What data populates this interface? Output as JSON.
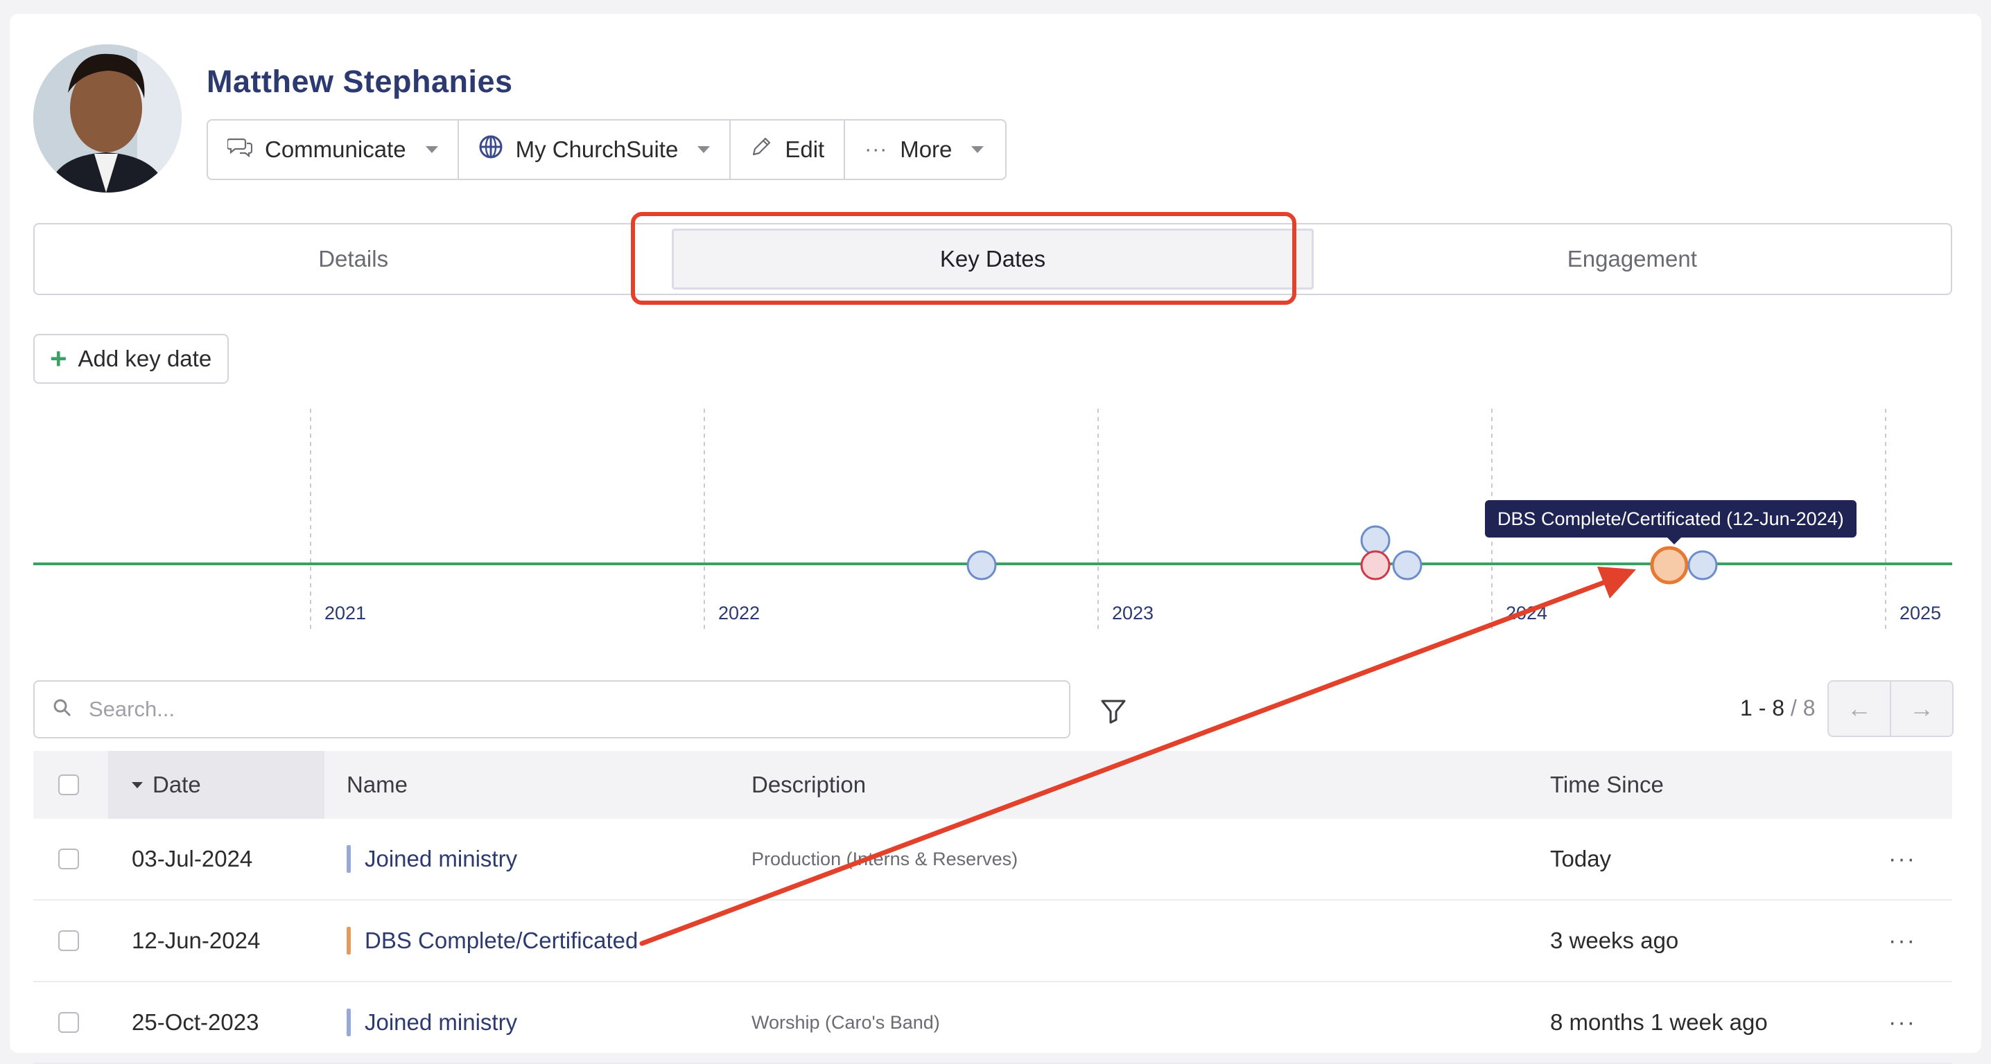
{
  "profile": {
    "name": "Matthew Stephanies",
    "actions": [
      {
        "label": "Communicate",
        "icon": "chat-bubbles-icon",
        "dropdown": true
      },
      {
        "label": "My ChurchSuite",
        "icon": "globe-icon",
        "dropdown": true
      },
      {
        "label": "Edit",
        "icon": "pencil-icon",
        "dropdown": false
      },
      {
        "label": "More",
        "icon": "ellipsis-icon",
        "dropdown": true
      }
    ]
  },
  "tabs": [
    {
      "label": "Details",
      "active": false
    },
    {
      "label": "Key Dates",
      "active": true
    },
    {
      "label": "Engagement",
      "active": false
    }
  ],
  "add_key_date_label": "Add key date",
  "timeline": {
    "years": [
      "2021",
      "2022",
      "2023",
      "2024",
      "2025"
    ],
    "tooltip": "DBS Complete/Certificated (12-Jun-2024)",
    "line_color": "#3aa063",
    "markers": [
      {
        "color": "blue",
        "row": 0
      },
      {
        "color": "blue",
        "row": 1
      },
      {
        "color": "red",
        "row": 0
      },
      {
        "color": "blue",
        "row": 0
      },
      {
        "color": "orange",
        "row": 0,
        "highlighted": true
      },
      {
        "color": "blue",
        "row": 0
      }
    ]
  },
  "search": {
    "placeholder": "Search..."
  },
  "pagination": {
    "range": "1 - 8",
    "total": "/ 8"
  },
  "table": {
    "columns": {
      "date": "Date",
      "name": "Name",
      "description": "Description",
      "time_since": "Time Since"
    },
    "rows": [
      {
        "date": "03-Jul-2024",
        "name": "Joined ministry",
        "description": "Production (Interns & Reserves)",
        "time_since": "Today",
        "color": "#97a9d6"
      },
      {
        "date": "12-Jun-2024",
        "name": "DBS Complete/Certificated",
        "description": "",
        "time_since": "3 weeks ago",
        "color": "#e59b5d"
      },
      {
        "date": "25-Oct-2023",
        "name": "Joined ministry",
        "description": "Worship (Caro's Band)",
        "time_since": "8 months 1 week ago",
        "color": "#97a9d6"
      }
    ]
  },
  "annotation": {
    "color": "#e2412b"
  }
}
